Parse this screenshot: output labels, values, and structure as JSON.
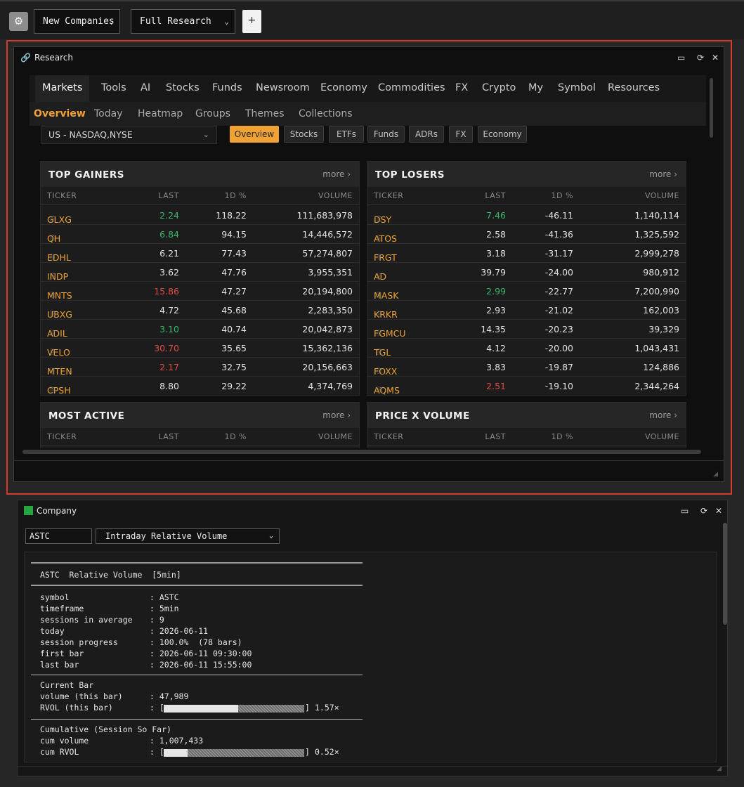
{
  "toolbar": {
    "settings_icon": "gear-icon",
    "layout_select": "New Companies",
    "research_select": "Full Research",
    "add_label": "+"
  },
  "research": {
    "title": "Research",
    "nav_tabs": [
      "Markets",
      "Tools",
      "AI",
      "Stocks",
      "Funds",
      "Newsroom",
      "Economy",
      "Commodities",
      "FX",
      "Crypto",
      "My",
      "Symbol",
      "Resources"
    ],
    "sub_tabs": [
      "Overview",
      "Today",
      "Heatmap",
      "Groups",
      "Themes",
      "Collections"
    ],
    "market_select": "US - NASDAQ,NYSE",
    "filters": [
      "Overview",
      "Stocks",
      "ETFs",
      "Funds",
      "ADRs",
      "FX",
      "Economy"
    ],
    "columns": [
      "TICKER",
      "LAST",
      "1D %",
      "VOLUME"
    ],
    "more_label": "more",
    "colors": {
      "accent": "#f0a235",
      "up": "#36b86b",
      "down": "#e04b47",
      "neutral": "#e2e2e2"
    },
    "top_gainers": {
      "title": "TOP GAINERS",
      "rows": [
        {
          "ticker": "GLXG",
          "last": "2.24",
          "dir": "up",
          "pct": "118.22",
          "volume": "111,683,978"
        },
        {
          "ticker": "QH",
          "last": "6.84",
          "dir": "up",
          "pct": "94.15",
          "volume": "14,446,572"
        },
        {
          "ticker": "EDHL",
          "last": "6.21",
          "dir": "neutral",
          "pct": "77.43",
          "volume": "57,274,807"
        },
        {
          "ticker": "INDP",
          "last": "3.62",
          "dir": "neutral",
          "pct": "47.76",
          "volume": "3,955,351"
        },
        {
          "ticker": "MNTS",
          "last": "15.86",
          "dir": "down",
          "pct": "47.27",
          "volume": "20,194,800"
        },
        {
          "ticker": "UBXG",
          "last": "4.72",
          "dir": "neutral",
          "pct": "45.68",
          "volume": "2,283,350"
        },
        {
          "ticker": "ADIL",
          "last": "3.10",
          "dir": "up",
          "pct": "40.74",
          "volume": "20,042,873"
        },
        {
          "ticker": "VELO",
          "last": "30.70",
          "dir": "down",
          "pct": "35.65",
          "volume": "15,362,136"
        },
        {
          "ticker": "MTEN",
          "last": "2.17",
          "dir": "down",
          "pct": "32.75",
          "volume": "20,156,663"
        },
        {
          "ticker": "CPSH",
          "last": "8.80",
          "dir": "neutral",
          "pct": "29.22",
          "volume": "4,374,769"
        }
      ]
    },
    "top_losers": {
      "title": "TOP LOSERS",
      "rows": [
        {
          "ticker": "DSY",
          "last": "7.46",
          "dir": "up",
          "pct": "-46.11",
          "volume": "1,140,114"
        },
        {
          "ticker": "ATOS",
          "last": "2.58",
          "dir": "neutral",
          "pct": "-41.36",
          "volume": "1,325,592"
        },
        {
          "ticker": "FRGT",
          "last": "3.18",
          "dir": "neutral",
          "pct": "-31.17",
          "volume": "2,999,278"
        },
        {
          "ticker": "AD",
          "last": "39.79",
          "dir": "neutral",
          "pct": "-24.00",
          "volume": "980,912"
        },
        {
          "ticker": "MASK",
          "last": "2.99",
          "dir": "up",
          "pct": "-22.77",
          "volume": "7,200,990"
        },
        {
          "ticker": "KRKR",
          "last": "2.93",
          "dir": "neutral",
          "pct": "-21.02",
          "volume": "162,003"
        },
        {
          "ticker": "FGMCU",
          "last": "14.35",
          "dir": "neutral",
          "pct": "-20.23",
          "volume": "39,329"
        },
        {
          "ticker": "TGL",
          "last": "4.12",
          "dir": "neutral",
          "pct": "-20.00",
          "volume": "1,043,431"
        },
        {
          "ticker": "FOXX",
          "last": "3.83",
          "dir": "neutral",
          "pct": "-19.87",
          "volume": "124,886"
        },
        {
          "ticker": "AQMS",
          "last": "2.51",
          "dir": "down",
          "pct": "-19.10",
          "volume": "2,344,264"
        }
      ]
    },
    "most_active": {
      "title": "MOST ACTIVE",
      "rows": []
    },
    "price_x_volume": {
      "title": "PRICE X VOLUME",
      "rows": []
    }
  },
  "company": {
    "title": "Company",
    "symbol_value": "ASTC",
    "study_select": "Intraday Relative Volume",
    "report": {
      "heading": "ASTC  Relative Volume  [5min]",
      "fields": [
        {
          "label": "symbol",
          "value": ": ASTC"
        },
        {
          "label": "timeframe",
          "value": ": 5min"
        },
        {
          "label": "sessions in average",
          "value": ": 9"
        },
        {
          "label": "today",
          "value": ": 2026-06-11"
        },
        {
          "label": "session progress",
          "value": ": 100.0%  (78 bars)"
        },
        {
          "label": "first bar",
          "value": ": 2026-06-11 09:30:00"
        },
        {
          "label": "last bar",
          "value": ": 2026-06-11 15:55:00"
        }
      ],
      "current_bar_title": "Current Bar",
      "current_bar": [
        {
          "label": "volume (this bar)",
          "value": ": 47,989"
        },
        {
          "label": "RVOL (this bar)",
          "value": "1.57×",
          "bar_fraction": 0.53
        }
      ],
      "cumulative_title": "Cumulative (Session So Far)",
      "cumulative": [
        {
          "label": "cum volume",
          "value": ": 1,007,433"
        },
        {
          "label": "cum RVOL",
          "value": "0.52×",
          "bar_fraction": 0.17
        }
      ]
    }
  }
}
